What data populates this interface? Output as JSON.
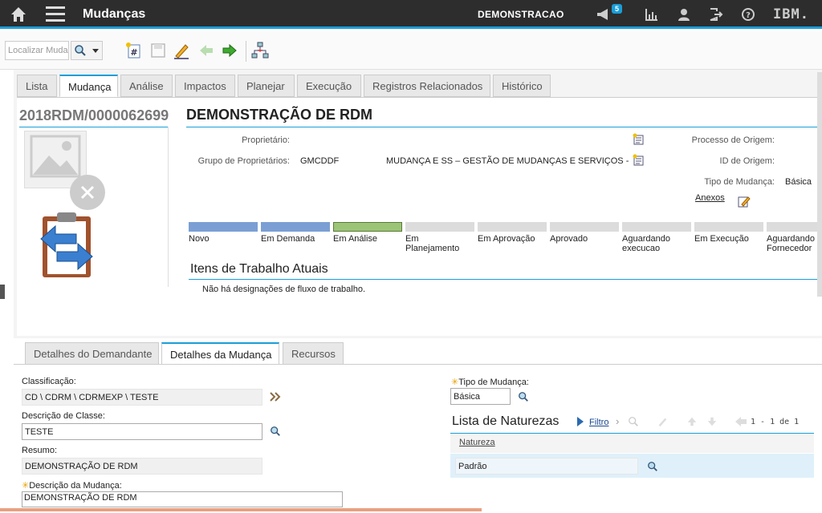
{
  "app": {
    "title": "Mudanças",
    "org": "DEMONSTRACAO",
    "notifications": "5",
    "brand": "IBM."
  },
  "toolbar": {
    "search_placeholder": "Localizar Muda"
  },
  "tabs": [
    "Lista",
    "Mudança",
    "Análise",
    "Impactos",
    "Planejar",
    "Execução",
    "Registros Relacionados",
    "Histórico"
  ],
  "record": {
    "id": "2018RDM/0000062699",
    "title": "DEMONSTRAÇÃO DE RDM"
  },
  "header_fields": {
    "owner_label": "Proprietário:",
    "owner_group_label": "Grupo de Proprietários:",
    "owner_group_value": "GMCDDF",
    "owner_group_desc": "MUDANÇA E SS – GESTÃO DE MUDANÇAS E SERVIÇOS -",
    "origin_process_label": "Processo de Origem:",
    "origin_id_label": "ID de Origem:",
    "change_type_label": "Tipo de Mudança:",
    "change_type_value": "Básica",
    "attachments_label": "Anexos"
  },
  "workflow_steps": [
    {
      "label": "Novo",
      "state": "done"
    },
    {
      "label": "Em Demanda",
      "state": "done"
    },
    {
      "label": "Em Análise",
      "state": "current"
    },
    {
      "label": "Em Planejamento",
      "state": "todo"
    },
    {
      "label": "Em Aprovação",
      "state": "todo"
    },
    {
      "label": "Aprovado",
      "state": "todo"
    },
    {
      "label": "Aguardando execucao",
      "state": "todo"
    },
    {
      "label": "Em Execução",
      "state": "todo"
    },
    {
      "label": "Aguardando Fornecedor",
      "state": "todo"
    }
  ],
  "work_items": {
    "title": "Itens de Trabalho Atuais",
    "empty": "Não há designações de fluxo de trabalho."
  },
  "subtabs": [
    "Detalhes do Demandante",
    "Detalhes da Mudança",
    "Recursos"
  ],
  "details": {
    "classification_label": "Classificação:",
    "classification_value": "CD \\ CDRM \\ CDRMEXP \\ TESTE",
    "class_desc_label": "Descrição de Classe:",
    "class_desc_value": "TESTE",
    "summary_label": "Resumo:",
    "summary_value": "DEMONSTRAÇÃO DE RDM",
    "change_desc_label": "Descrição da Mudança:",
    "change_desc_value": "DEMONSTRAÇÃO DE RDM",
    "change_type_label": "Tipo de Mudança:",
    "change_type_value": "Básica"
  },
  "natures": {
    "title": "Lista de Naturezas",
    "filter_label": "Filtro",
    "pagination": "1 - 1 de 1",
    "column": "Natureza",
    "rows": [
      "Padrão"
    ]
  }
}
